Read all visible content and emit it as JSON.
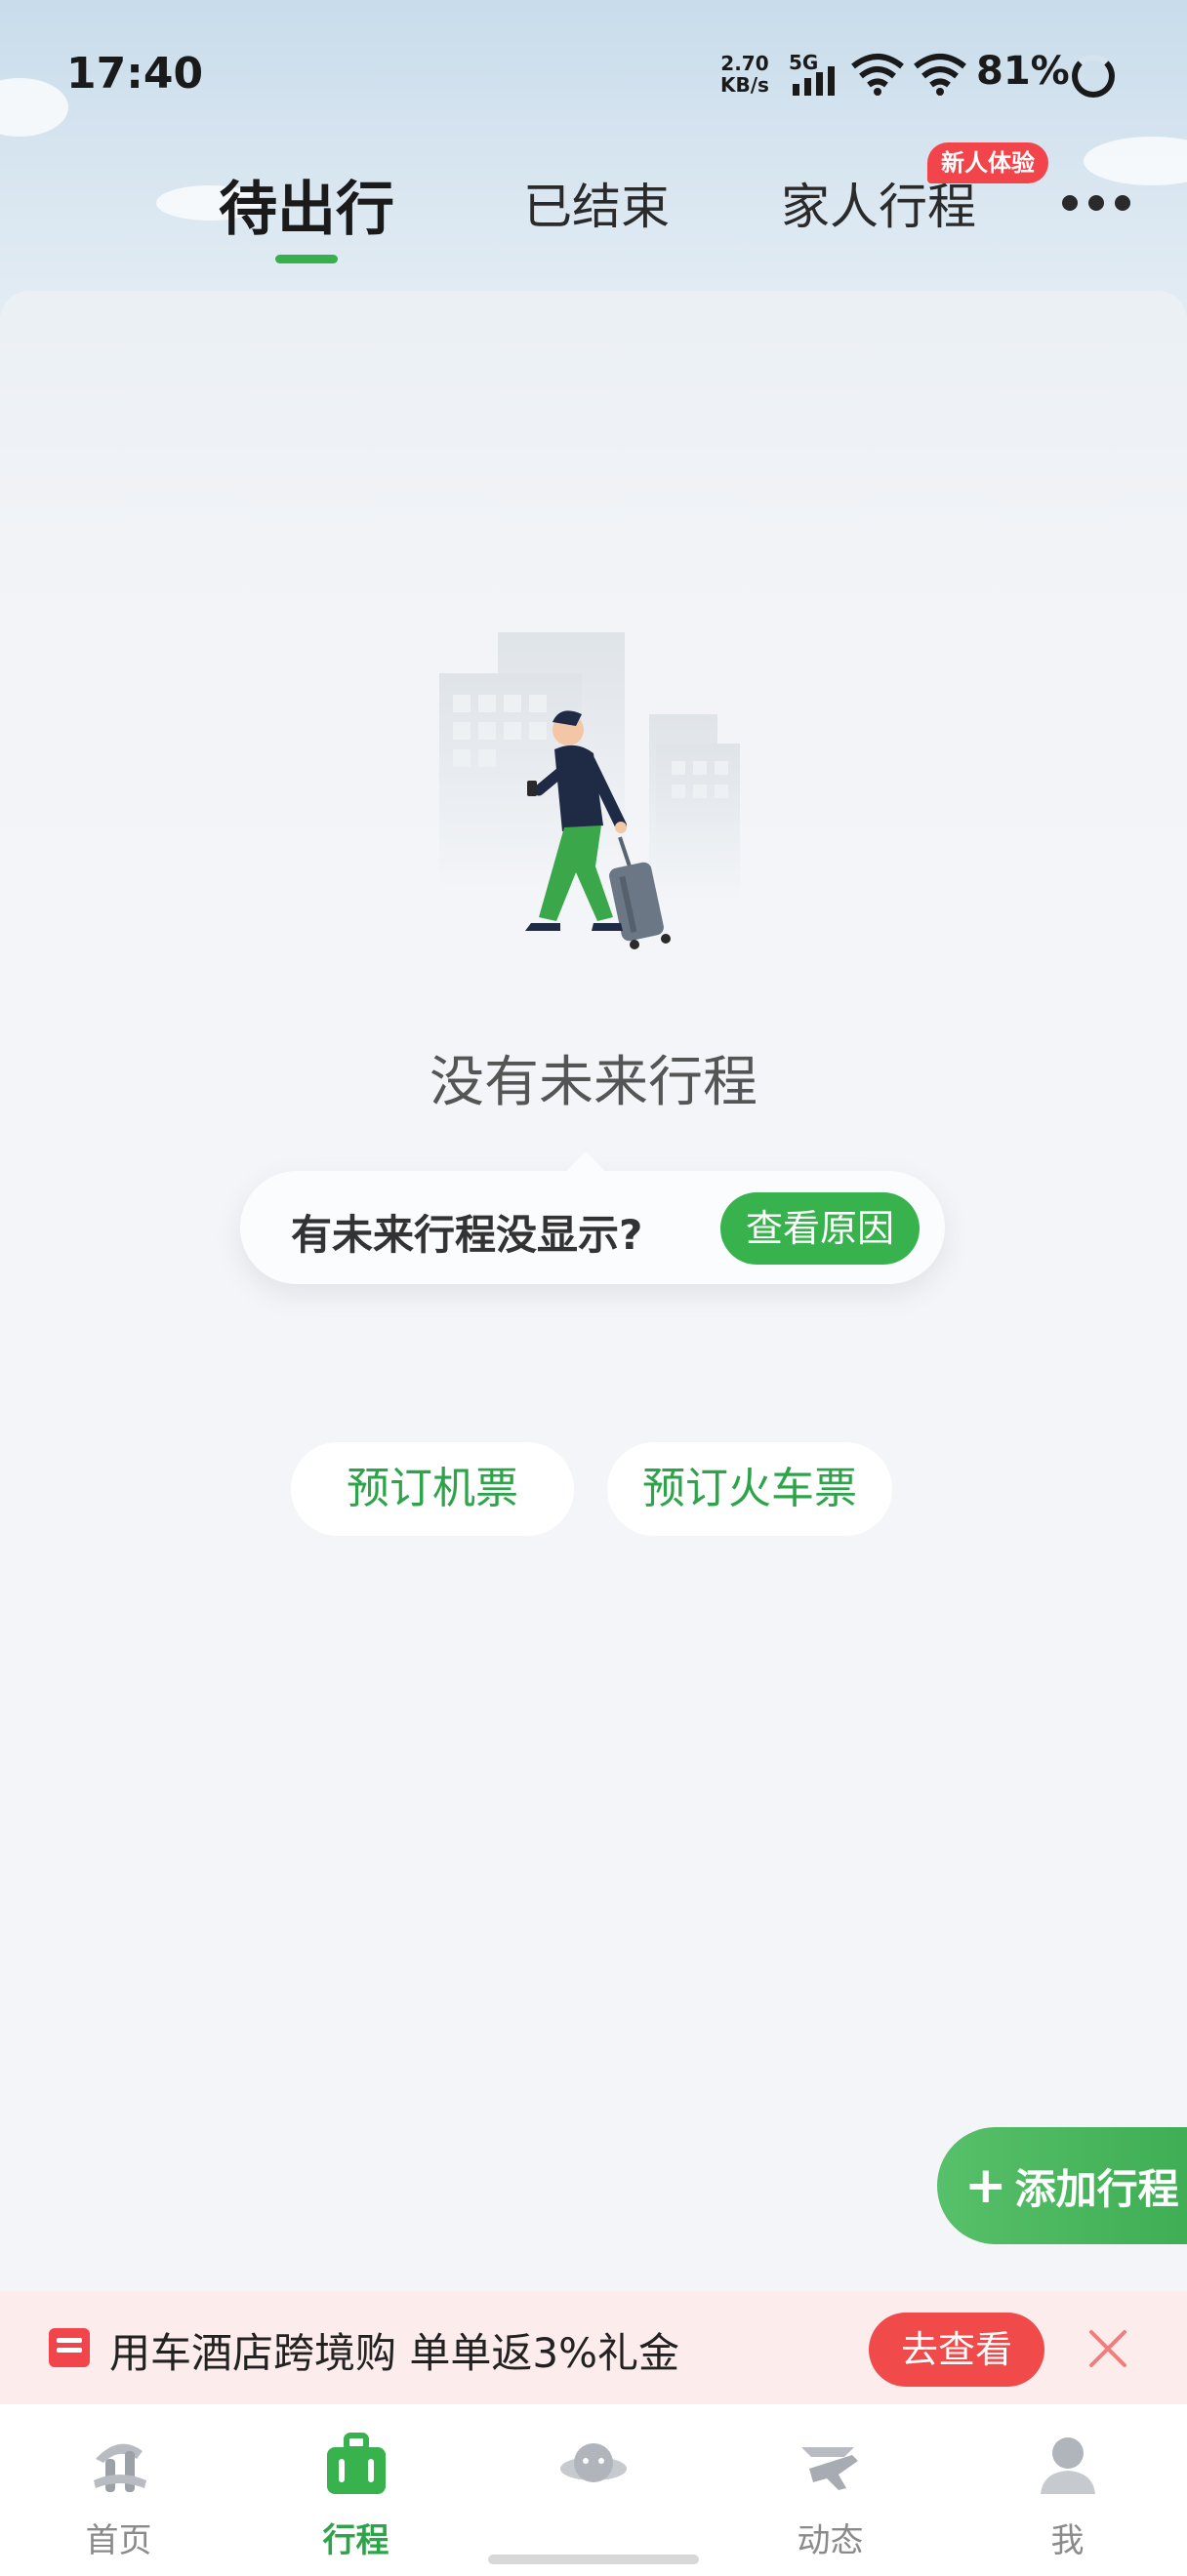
{
  "status_bar": {
    "time": "17:40",
    "net_speed_value": "2.70",
    "net_speed_unit": "KB/s",
    "network": "5G",
    "battery": "81%"
  },
  "tabs": [
    {
      "label": "待出行",
      "active": true
    },
    {
      "label": "已结束",
      "active": false
    },
    {
      "label": "家人行程",
      "active": false,
      "badge": "新人体验"
    }
  ],
  "empty_state": {
    "title": "没有未来行程",
    "hint_text": "有未来行程没显示?",
    "hint_button": "查看原因"
  },
  "booking": {
    "flight_label": "预订机票",
    "train_label": "预订火车票"
  },
  "add_trip_label": "添加行程",
  "promo": {
    "text": "用车酒店跨境购 单单返3%礼金",
    "button": "去查看"
  },
  "bottom_nav": [
    {
      "label": "首页",
      "icon": "home-icon",
      "active": false
    },
    {
      "label": "行程",
      "icon": "suitcase-icon",
      "active": true
    },
    {
      "label": "",
      "icon": "planet-icon",
      "active": false
    },
    {
      "label": "动态",
      "icon": "flight-status-icon",
      "active": false
    },
    {
      "label": "我",
      "icon": "profile-icon",
      "active": false
    }
  ],
  "colors": {
    "accent_green": "#38b24d",
    "promo_red": "#f04a4a",
    "badge_red": "#f2454b"
  }
}
